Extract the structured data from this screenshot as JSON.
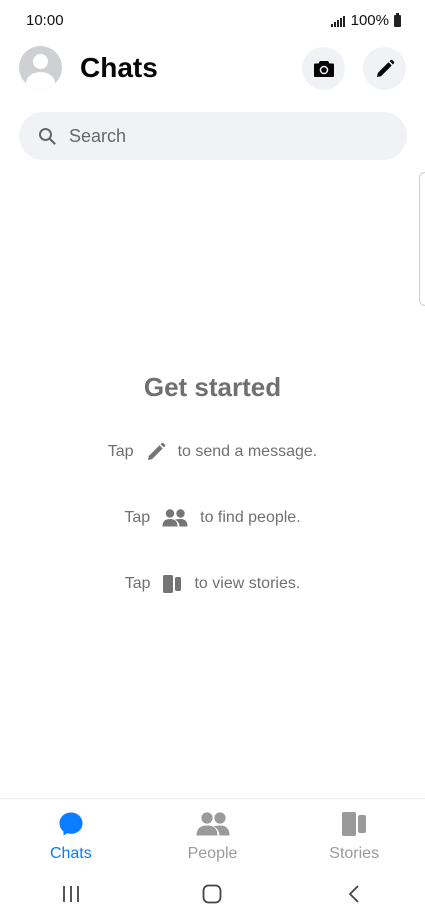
{
  "status_bar": {
    "time": "10:00",
    "battery": "100%"
  },
  "header": {
    "title": "Chats"
  },
  "search": {
    "placeholder": "Search"
  },
  "empty_state": {
    "title": "Get started",
    "hints": [
      {
        "prefix": "Tap",
        "icon": "pencil-icon",
        "suffix": "to send a message."
      },
      {
        "prefix": "Tap",
        "icon": "people-icon",
        "suffix": "to find people."
      },
      {
        "prefix": "Tap",
        "icon": "stories-icon",
        "suffix": "to view stories."
      }
    ]
  },
  "bottom_nav": {
    "items": [
      {
        "label": "Chats",
        "icon": "chat-bubble-icon",
        "active": true
      },
      {
        "label": "People",
        "icon": "people-icon",
        "active": false
      },
      {
        "label": "Stories",
        "icon": "stories-icon",
        "active": false
      }
    ]
  },
  "system_nav": {
    "icons": [
      "recent-apps-icon",
      "home-icon",
      "back-icon"
    ]
  },
  "colors": {
    "accent": "#0a7cff",
    "inactive": "#9a9a9a",
    "hint_text": "#707070",
    "button_bg": "#f0f2f5"
  }
}
